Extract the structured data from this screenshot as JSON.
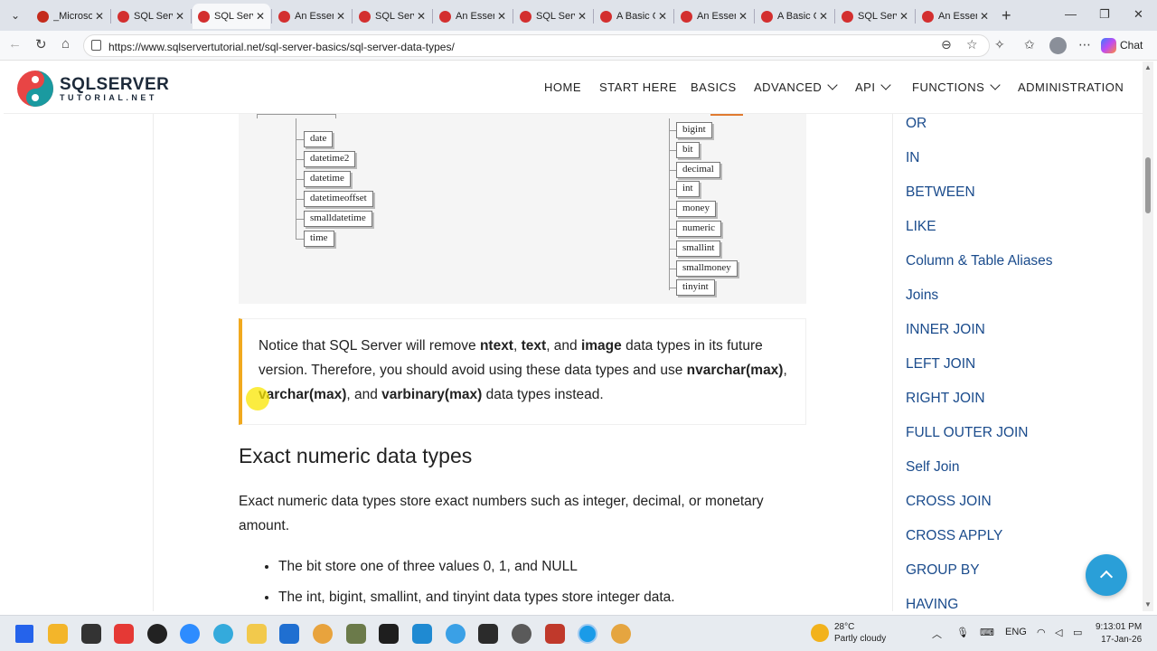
{
  "browser": {
    "tabs": [
      {
        "label": "_Microso",
        "color": "#c42b1c",
        "active": false
      },
      {
        "label": "SQL Serve",
        "color": "#d32f2f",
        "active": false
      },
      {
        "label": "SQL Serve",
        "color": "#d32f2f",
        "active": true
      },
      {
        "label": "An Essenti",
        "color": "#d32f2f",
        "active": false
      },
      {
        "label": "SQL Serve",
        "color": "#d32f2f",
        "active": false
      },
      {
        "label": "An Essenti",
        "color": "#d32f2f",
        "active": false
      },
      {
        "label": "SQL Serve",
        "color": "#d32f2f",
        "active": false
      },
      {
        "label": "A Basic G",
        "color": "#d32f2f",
        "active": false
      },
      {
        "label": "An Essenti",
        "color": "#d32f2f",
        "active": false
      },
      {
        "label": "A Basic G",
        "color": "#d32f2f",
        "active": false
      },
      {
        "label": "SQL Serve",
        "color": "#d32f2f",
        "active": false
      },
      {
        "label": "An Essenti",
        "color": "#d32f2f",
        "active": false
      }
    ],
    "new_tab_icon": "+",
    "url": "https://www.sqlservertutorial.net/sql-server-basics/sql-server-data-types/",
    "chat_label": "Chat"
  },
  "site": {
    "logo_line1": "SQLSERVER",
    "logo_line2": "TUTORIAL.NET",
    "nav": [
      {
        "label": "HOME",
        "dropdown": false,
        "active": false
      },
      {
        "label": "START HERE",
        "dropdown": false,
        "active": false
      },
      {
        "label": "BASICS",
        "dropdown": false,
        "active": true
      },
      {
        "label": "ADVANCED",
        "dropdown": true,
        "active": false
      },
      {
        "label": "API",
        "dropdown": true,
        "active": false
      },
      {
        "label": "FUNCTIONS",
        "dropdown": true,
        "active": false
      },
      {
        "label": "ADMINISTRATION",
        "dropdown": false,
        "active": false
      }
    ]
  },
  "figure": {
    "datetime_types": [
      "date",
      "datetime2",
      "datetime",
      "datetimeoffset",
      "smalldatetime",
      "time"
    ],
    "exact_numeric_types": [
      "bigint",
      "bit",
      "decimal",
      "int",
      "money",
      "numeric",
      "smallint",
      "smallmoney",
      "tinyint"
    ]
  },
  "note": {
    "t1": "Notice that SQL Server will remove ",
    "b1": "ntext",
    "t2": ", ",
    "b2": "text",
    "t3": ", and ",
    "b3": "image",
    "t4": " data types in its future version. Therefore, you should avoid using these data types and use ",
    "b4": "nvarchar(max)",
    "t5": ", ",
    "b5": "varchar(max)",
    "t6": ", and ",
    "b6": "varbinary(max)",
    "t7": " data types instead."
  },
  "content": {
    "heading": "Exact numeric data types",
    "paragraph": "Exact numeric data types store exact numbers such as integer, decimal, or monetary amount.",
    "bullets": [
      "The bit store one of three values 0, 1, and NULL",
      "The int, bigint, smallint, and tinyint data types store integer data."
    ]
  },
  "sidebar": {
    "links": [
      "OR",
      "IN",
      "BETWEEN",
      "LIKE",
      "Column & Table Aliases",
      "Joins",
      "INNER JOIN",
      "LEFT JOIN",
      "RIGHT JOIN",
      "FULL OUTER JOIN",
      "Self Join",
      "CROSS JOIN",
      "CROSS APPLY",
      "GROUP BY",
      "HAVING"
    ]
  },
  "taskbar": {
    "weather_temp": "28°C",
    "weather_desc": "Partly cloudy",
    "lang": "ENG",
    "time": "9:13:01 PM",
    "date": "17-Jan-26"
  },
  "colors": {
    "accent_blue": "#1a4b8c",
    "note_border": "#f1a91e",
    "back_to_top": "#2a9fd8"
  }
}
